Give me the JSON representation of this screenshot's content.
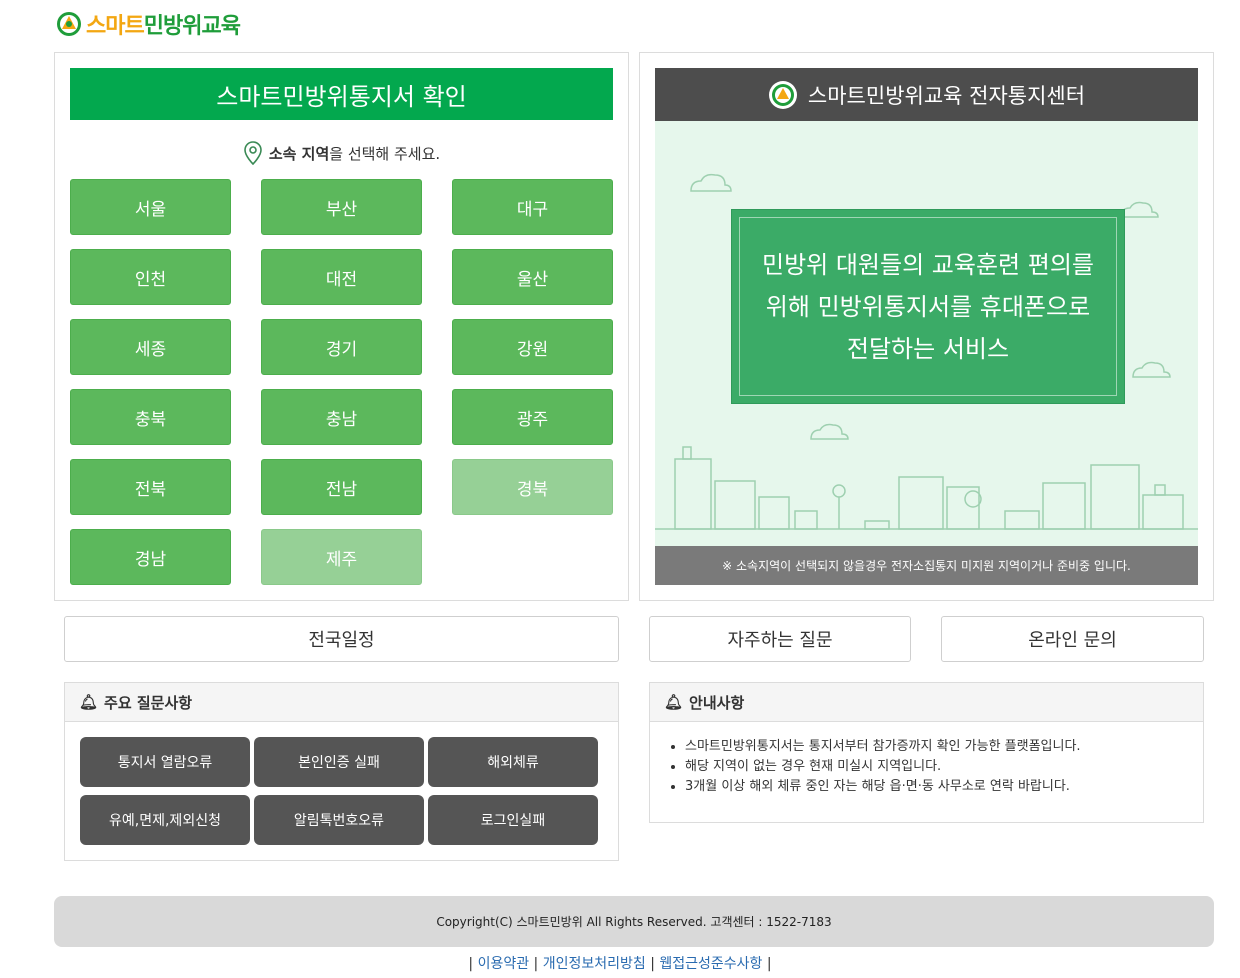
{
  "logo": {
    "part1": "스마트",
    "part2": "민방위교육"
  },
  "left_panel": {
    "title": "스마트민방위통지서 확인",
    "hint_bold": "소속 지역",
    "hint_rest": "을 선택해 주세요.",
    "regions": [
      {
        "label": "서울",
        "enabled": true
      },
      {
        "label": "부산",
        "enabled": true
      },
      {
        "label": "대구",
        "enabled": true
      },
      {
        "label": "인천",
        "enabled": true
      },
      {
        "label": "대전",
        "enabled": true
      },
      {
        "label": "울산",
        "enabled": true
      },
      {
        "label": "세종",
        "enabled": true
      },
      {
        "label": "경기",
        "enabled": true
      },
      {
        "label": "강원",
        "enabled": true
      },
      {
        "label": "충북",
        "enabled": true
      },
      {
        "label": "충남",
        "enabled": true
      },
      {
        "label": "광주",
        "enabled": true
      },
      {
        "label": "전북",
        "enabled": true
      },
      {
        "label": "전남",
        "enabled": true
      },
      {
        "label": "경북",
        "enabled": false
      },
      {
        "label": "경남",
        "enabled": true
      },
      {
        "label": "제주",
        "enabled": false
      }
    ]
  },
  "right_panel": {
    "title": "스마트민방위교육 전자통지센터",
    "promo_line1": "민방위 대원들의 교육훈련 편의를",
    "promo_line2": "위해 민방위통지서를 휴대폰으로",
    "promo_line3": "전달하는 서비스",
    "notice": "※ 소속지역이 선택되지 않을경우 전자소집통지 미지원 지역이거나 준비중 입니다."
  },
  "buttons": {
    "schedule": "전국일정",
    "faq": "자주하는 질문",
    "inquiry": "온라인 문의"
  },
  "faq_box": {
    "title": "주요 질문사항",
    "items": [
      "통지서 열람오류",
      "본인인증 실패",
      "해외체류",
      "유예,면제,제외신청",
      "알림톡번호오류",
      "로그인실패"
    ]
  },
  "info_box": {
    "title": "안내사항",
    "items": [
      "스마트민방위통지서는 통지서부터 참가증까지 확인 가능한 플랫폼입니다.",
      "해당 지역이 없는 경우 현재 미실시 지역입니다.",
      "3개월 이상 해외 체류 중인 자는 해당 읍·면·동 사무소로 연락 바랍니다."
    ]
  },
  "footer": {
    "copyright": "Copyright(C) 스마트민방위 All Rights Reserved. 고객센터 : 1522-7183",
    "links": [
      "이용약관",
      "개인정보처리방침",
      "웹접근성준수사항"
    ]
  },
  "colors": {
    "primary_green": "#03a84e",
    "region_green": "#5cb85c",
    "region_disabled": "#96d096",
    "dark_header": "#4d4d4d",
    "faq_button": "#555555"
  }
}
